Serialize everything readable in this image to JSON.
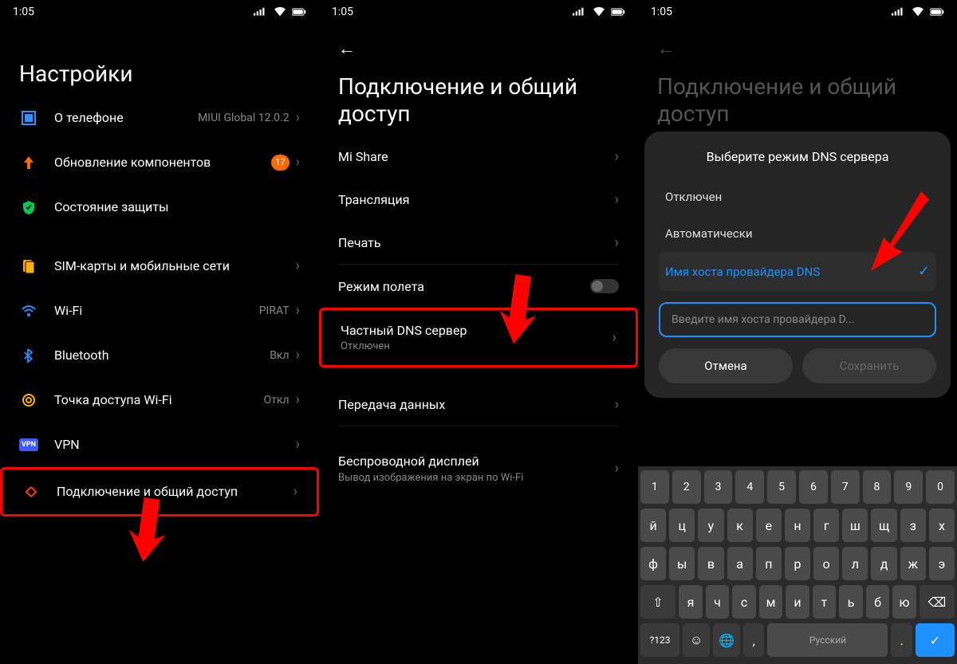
{
  "status": {
    "time": "1:05"
  },
  "phone1": {
    "title": "Настройки",
    "items": {
      "about": {
        "label": "О телефоне",
        "value": "MIUI Global 12.0.2"
      },
      "updates": {
        "label": "Обновление компонентов",
        "badge": "17"
      },
      "security": {
        "label": "Состояние защиты"
      },
      "sim": {
        "label": "SIM-карты и мобильные сети"
      },
      "wifi": {
        "label": "Wi-Fi",
        "value": "PIRAT"
      },
      "bluetooth": {
        "label": "Bluetooth",
        "value": "Вкл"
      },
      "hotspot": {
        "label": "Точка доступа Wi-Fi",
        "value": "Откл"
      },
      "vpn": {
        "label": "VPN"
      },
      "connection": {
        "label": "Подключение и общий доступ"
      }
    }
  },
  "phone2": {
    "title": "Подключение и общий доступ",
    "items": {
      "mishare": {
        "label": "Mi Share"
      },
      "cast": {
        "label": "Трансляция"
      },
      "print": {
        "label": "Печать"
      },
      "airplane": {
        "label": "Режим полета"
      },
      "dns": {
        "label": "Частный DNS сервер",
        "sub": "Отключен"
      },
      "data": {
        "label": "Передача данных"
      },
      "wireless": {
        "label": "Беспроводной дисплей",
        "sub": "Вывод изображения на экран по Wi-Fi"
      }
    }
  },
  "phone3": {
    "title": "Подключение и общий доступ",
    "dialog": {
      "title": "Выберите режим DNS сервера",
      "off": "Отключен",
      "auto": "Автоматически",
      "host": "Имя хоста провайдера DNS",
      "placeholder": "Введите имя хоста провайдера D...",
      "cancel": "Отмена",
      "save": "Сохранить"
    },
    "keyboard": {
      "numrow": [
        "1",
        "2",
        "3",
        "4",
        "5",
        "6",
        "7",
        "8",
        "9",
        "0"
      ],
      "row1": [
        "й",
        "ц",
        "у",
        "к",
        "е",
        "н",
        "г",
        "ш",
        "щ",
        "з",
        "х"
      ],
      "row2": [
        "ф",
        "ы",
        "в",
        "а",
        "п",
        "р",
        "о",
        "л",
        "д",
        "ж",
        "э"
      ],
      "row3": [
        "я",
        "ч",
        "с",
        "м",
        "и",
        "т",
        "ь",
        "б",
        "ю"
      ],
      "sym": "?123",
      "lang": "Русский"
    }
  }
}
